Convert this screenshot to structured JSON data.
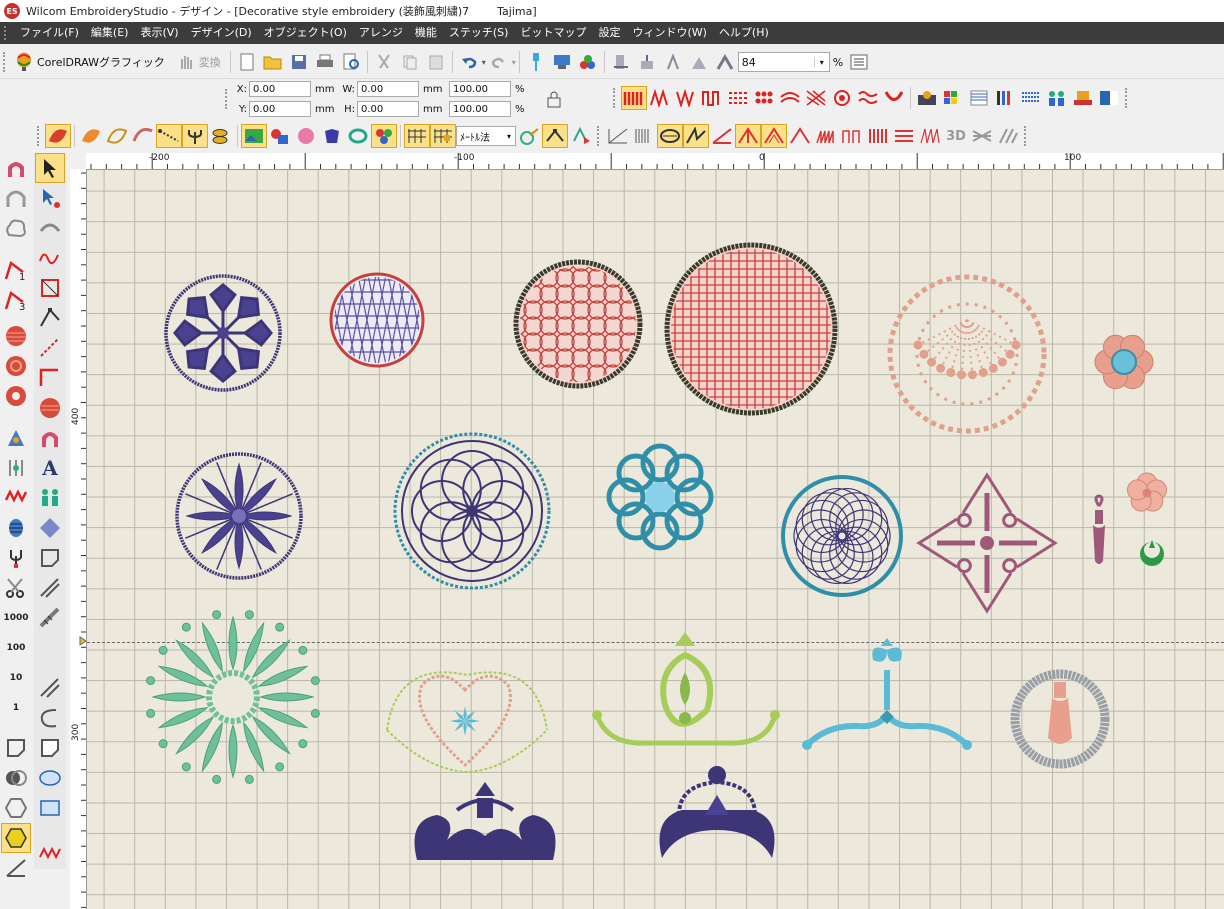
{
  "window": {
    "title": "Wilcom EmbroideryStudio - デザイン - [Decorative style embroidery (装飾風刺繍)7        Tajima]",
    "app_icon": "ES"
  },
  "menu": {
    "items": [
      "ファイル(F)",
      "編集(E)",
      "表示(V)",
      "デザイン(D)",
      "オブジェクト(O)",
      "アレンジ",
      "機能",
      "ステッチ(S)",
      "ビットマップ",
      "設定",
      "ウィンドウ(W)",
      "ヘルプ(H)"
    ]
  },
  "toolbar": {
    "coreldraw_label": "CorelDRAWグラフィック",
    "convert_label": "変換",
    "zoom_value": "84",
    "zoom_unit": "%",
    "method_label": "ﾒｰﾄﾙ法"
  },
  "props": {
    "x_label": "X:",
    "x_value": "0.00",
    "x_unit": "mm",
    "y_label": "Y:",
    "y_value": "0.00",
    "y_unit": "mm",
    "w_label": "W:",
    "w_value": "0.00",
    "w_unit": "mm",
    "h_label": "H:",
    "h_value": "0.00",
    "h_unit": "mm",
    "sx_value": "100.00",
    "sx_unit": "%",
    "sy_value": "100.00",
    "sy_unit": "%"
  },
  "ruler": {
    "top_labels": [
      "-200",
      "-100",
      "0",
      "100"
    ],
    "left_labels": [
      "400",
      "300"
    ]
  },
  "left_tools": {
    "num_1000": "1000",
    "num_100": "100",
    "num_10": "10",
    "num_1": "1",
    "text_tool": "A",
    "badge_1": "1",
    "badge_3": "3"
  },
  "labels": {
    "three_d": "3D"
  },
  "colors": {
    "navy": "#3d3575",
    "red": "#c8403c",
    "dark": "#3a3a2a",
    "salmon": "#e0a08c",
    "teal": "#2f8ea8",
    "mint": "#6fc09a",
    "lime": "#a8cc5a",
    "sky": "#5bbad6",
    "mauve": "#a0587a",
    "silver": "#9a9ea6"
  }
}
